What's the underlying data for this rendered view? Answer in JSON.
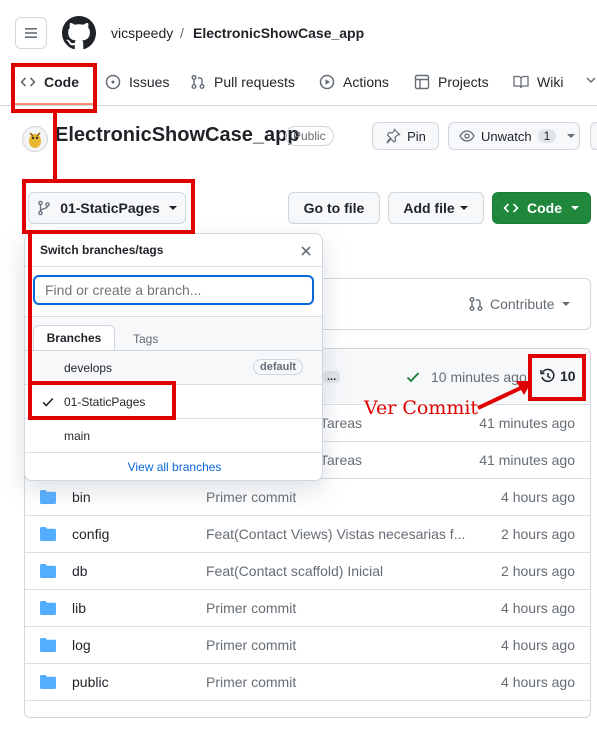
{
  "header": {
    "owner": "vicspeedy",
    "separator": "/",
    "repo": "ElectronicShowCase_app"
  },
  "nav": {
    "code": "Code",
    "issues": "Issues",
    "pull_requests": "Pull requests",
    "actions": "Actions",
    "projects": "Projects",
    "wiki": "Wiki"
  },
  "repo_header": {
    "title": "ElectronicShowCase_app",
    "visibility": "Public",
    "pin": "Pin",
    "unwatch": "Unwatch",
    "watch_count": "1"
  },
  "toolbar": {
    "branch": "01-StaticPages",
    "go_to_file": "Go to file",
    "add_file": "Add file",
    "code": "Code"
  },
  "contribute": "Contribute",
  "latest_commit": {
    "ellipsis": "...",
    "time": "10 minutes ago",
    "commit_count": "10"
  },
  "annotation": {
    "label": "Ver Commit"
  },
  "dropdown": {
    "title": "Switch branches/tags",
    "placeholder": "Find or create a branch...",
    "tab_branches": "Branches",
    "tab_tags": "Tags",
    "branches": [
      {
        "name": "develops",
        "badge": "default"
      },
      {
        "name": "01-StaticPages"
      },
      {
        "name": "main"
      }
    ],
    "view_all": "View all branches"
  },
  "partial_rows": [
    {
      "msg": "Tareas",
      "time": "41 minutes ago"
    },
    {
      "msg": "Tareas",
      "time": "41 minutes ago"
    }
  ],
  "files": [
    {
      "name": "bin",
      "msg": "Primer commit",
      "time": "4 hours ago"
    },
    {
      "name": "config",
      "msg": "Feat(Contact Views) Vistas necesarias f...",
      "time": "2 hours ago"
    },
    {
      "name": "db",
      "msg": "Feat(Contact scaffold) Inicial",
      "time": "2 hours ago"
    },
    {
      "name": "lib",
      "msg": "Primer commit",
      "time": "4 hours ago"
    },
    {
      "name": "log",
      "msg": "Primer commit",
      "time": "4 hours ago"
    },
    {
      "name": "public",
      "msg": "Primer commit",
      "time": "4 hours ago"
    }
  ],
  "colors": {
    "annotation_red": "#e00000",
    "primary_green": "#1f883d",
    "link_blue": "#0969da",
    "folder_blue": "#54aeff"
  }
}
